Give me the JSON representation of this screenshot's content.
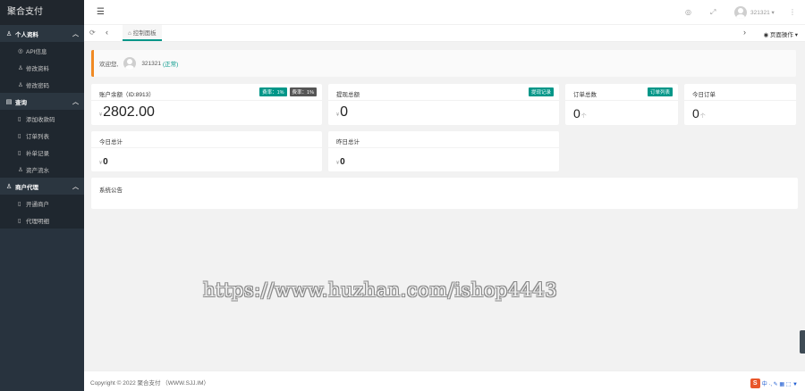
{
  "app": {
    "logo": "聚合支付"
  },
  "sidebar": {
    "groups": [
      {
        "label": "个人资料",
        "icon": "user-icon",
        "items": [
          {
            "label": "API信息",
            "icon": "api-icon"
          },
          {
            "label": "修改资料",
            "icon": "user-icon"
          },
          {
            "label": "修改密码",
            "icon": "user-icon"
          }
        ]
      },
      {
        "label": "查询",
        "icon": "file-icon",
        "items": [
          {
            "label": "添加收款码",
            "icon": "file-icon"
          },
          {
            "label": "订单列表",
            "icon": "file-icon"
          },
          {
            "label": "补单记录",
            "icon": "file-icon"
          },
          {
            "label": "资产流水",
            "icon": "user-icon"
          }
        ]
      },
      {
        "label": "商户代理",
        "icon": "user-icon",
        "items": [
          {
            "label": "开通商户",
            "icon": "file-icon"
          },
          {
            "label": "代理明细",
            "icon": "file-icon"
          }
        ]
      }
    ]
  },
  "topbar": {
    "menu_icon": "☰",
    "theme_icon": "◎",
    "fullscreen_icon": "⤢",
    "username": "321321 ▾",
    "more_icon": "⋮"
  },
  "tabs": {
    "refresh_icon": "⟳",
    "prev_icon": "‹",
    "home_label": "⌂ 控制面板",
    "next_icon": "›",
    "page_ops": "◉ 页面操作 ▾"
  },
  "welcome": {
    "greeting": "欢迎您,",
    "username": "321321",
    "status": "(正常)"
  },
  "cards": {
    "balance": {
      "title": "账户余额（ID:8913）",
      "badge_fee": "费率：1%",
      "badge_rate": "费率：1%",
      "currency": "¥",
      "value": "2802.00"
    },
    "withdraw": {
      "title": "提现总额",
      "badge": "提现记录",
      "currency": "¥",
      "value": "0"
    },
    "orders_total": {
      "title": "订单总数",
      "badge": "订单列表",
      "value": "0",
      "unit": "个"
    },
    "orders_today": {
      "title": "今日订单",
      "value": "0",
      "unit": "个"
    },
    "today_income": {
      "title": "今日总计",
      "currency": "¥",
      "value": "0"
    },
    "yesterday_income": {
      "title": "昨日总计",
      "currency": "¥",
      "value": "0"
    }
  },
  "notice": {
    "title": "系统公告"
  },
  "watermark": "https://www.huzhan.com/ishop4443",
  "footer": {
    "copyright": "Copyright © 2022 聚合支付 （WWW.SJJ.IM）",
    "ime_logo": "S",
    "ime_lang": "中 ·, ✎ ▦ ⬚ ▼"
  },
  "colors": {
    "sidebar": "#28333e",
    "accent": "#009688",
    "welcome_border": "#f08a24"
  }
}
